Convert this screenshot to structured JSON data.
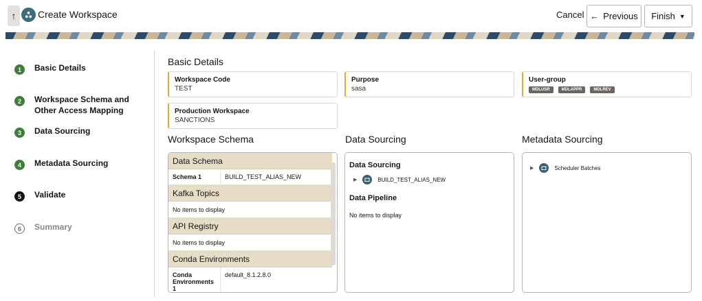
{
  "header": {
    "title": "Create Workspace",
    "cancel_label": "Cancel",
    "previous_label": "Previous",
    "finish_label": "Finish"
  },
  "steps": [
    {
      "num": "1",
      "label": "Basic Details",
      "state": "done"
    },
    {
      "num": "2",
      "label": "Workspace Schema and Other Access Mapping",
      "state": "done"
    },
    {
      "num": "3",
      "label": "Data Sourcing",
      "state": "done"
    },
    {
      "num": "4",
      "label": "Metadata Sourcing",
      "state": "done"
    },
    {
      "num": "5",
      "label": "Validate",
      "state": "current"
    },
    {
      "num": "6",
      "label": "Summary",
      "state": "todo"
    }
  ],
  "basic_details": {
    "title": "Basic Details",
    "workspace_code": {
      "label": "Workspace Code",
      "value": "TEST"
    },
    "purpose": {
      "label": "Purpose",
      "value": "sasa"
    },
    "user_group": {
      "label": "User-group",
      "badges": [
        "MDLUSR",
        "MDLAPPR",
        "MDLREV"
      ]
    },
    "production_workspace": {
      "label": "Production Workspace",
      "value": "SANCTIONS"
    }
  },
  "workspace_schema": {
    "title": "Workspace Schema",
    "data_schema": {
      "header": "Data Schema",
      "key": "Schema 1",
      "value": "BUILD_TEST_ALIAS_NEW"
    },
    "kafka": {
      "header": "Kafka Topics",
      "empty": "No items to display"
    },
    "api": {
      "header": "API Registry",
      "empty": "No items to display"
    },
    "conda": {
      "header": "Conda Environments",
      "key": "Conda Environments 1",
      "value": "default_8.1.2.8.0"
    }
  },
  "data_sourcing": {
    "title": "Data Sourcing",
    "panel_title": "Data Sourcing",
    "item": "BUILD_TEST_ALIAS_NEW",
    "pipeline_title": "Data Pipeline",
    "pipeline_empty": "No items to display"
  },
  "metadata_sourcing": {
    "title": "Metadata Sourcing",
    "item": "Scheduler Batches"
  },
  "colors": {
    "accent": "#e8a92f",
    "done": "#3f7d3a",
    "icon": "#3b6e7c"
  }
}
